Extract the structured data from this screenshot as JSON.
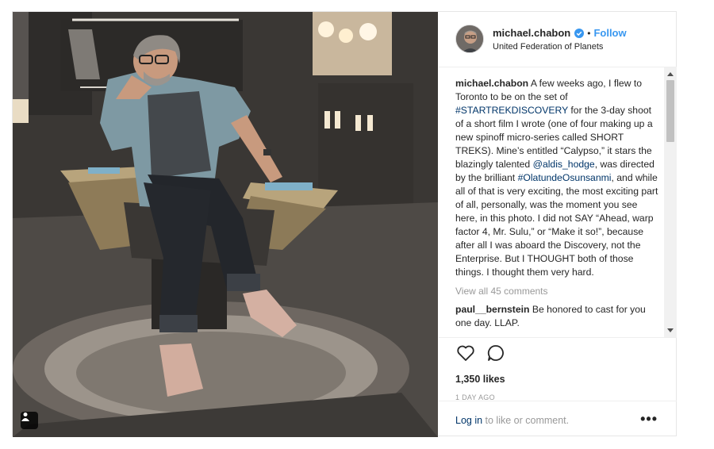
{
  "post": {
    "username": "michael.chabon",
    "follow_label": "Follow",
    "separator": "•",
    "location": "United Federation of Planets",
    "caption": {
      "username": "michael.chabon",
      "text_1": " A few weeks ago, I flew to Toronto to be on the set of ",
      "hashtag_1": "#STARTREKDISCOVERY",
      "text_2": " for the 3-day shoot of a short film I wrote (one of four making up a new spinoff micro-series called SHORT TREKS). Mine’s entitled “Calypso,” it stars the blazingly talented ",
      "mention_1": "@aldis_hodge",
      "text_3": ", was directed by the brilliant ",
      "hashtag_2": "#OlatundeOsunsanmi",
      "text_4": ", and while all of that is very exciting, the most exciting part of all, personally, was the moment you see here, in this photo. I did not SAY “Ahead, warp factor 4, Mr. Sulu,” or “Make it so!”, because after all I was aboard the Discovery, not the Enterprise. But I THOUGHT both of those things. I thought them very hard."
    },
    "view_all_comments": "View all 45 comments",
    "comments": [
      {
        "username": "paul__bernstein",
        "text": " Be honored to cast for you one day. LLAP."
      }
    ],
    "likes": "1,350 likes",
    "timestamp": "1 DAY AGO",
    "login_link": "Log in",
    "login_suffix": " to like or comment.",
    "more_options": "•••"
  },
  "icons": {
    "verified": "verified-badge-icon",
    "like": "heart-icon",
    "comment": "comment-bubble-icon",
    "user_tag": "person-icon"
  },
  "colors": {
    "link_blue": "#3897f0",
    "hashtag": "#003569",
    "muted": "#999999",
    "text": "#262626"
  }
}
